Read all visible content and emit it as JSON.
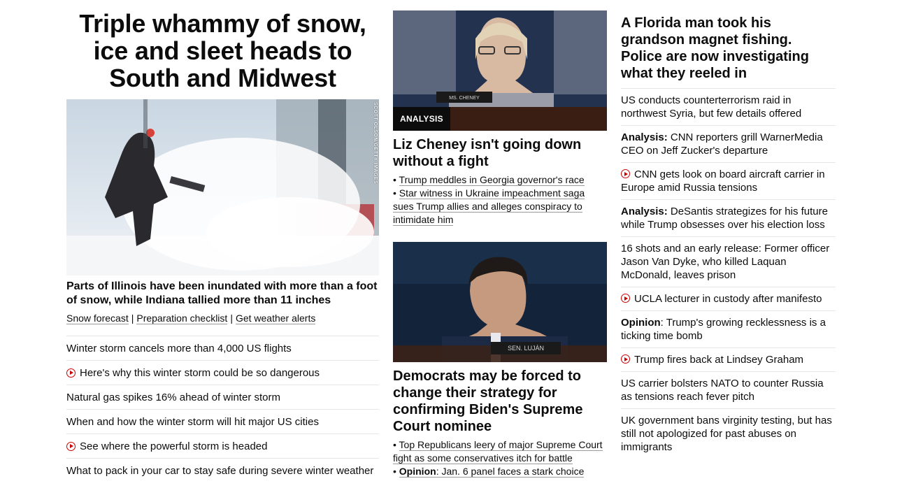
{
  "hero": {
    "title": "Triple whammy of snow, ice and sleet heads to South and Midwest",
    "image_credit": "SCOTT OLSON/GETTY IMAGES",
    "subhead": "Parts of Illinois have been inundated with more than a foot of snow, while Indiana tallied more than 11 inches",
    "links": [
      "Snow forecast",
      "Preparation checklist",
      "Get weather alerts"
    ],
    "separator": "|"
  },
  "storm_list": [
    {
      "text": "Winter storm cancels more than 4,000 US flights",
      "video": false
    },
    {
      "text": "Here's why this winter storm could be so dangerous",
      "video": true
    },
    {
      "text": "Natural gas spikes 16% ahead of winter storm",
      "video": false
    },
    {
      "text": "When and how the winter storm will hit major US cities",
      "video": false
    },
    {
      "text": "See where the powerful storm is headed",
      "video": true
    },
    {
      "text": "What to pack in your car to stay safe during severe winter weather",
      "video": false
    }
  ],
  "cheney": {
    "badge": "ANALYSIS",
    "nameplate": "MS. CHENEY",
    "headline": "Liz Cheney isn't going down without a fight",
    "bullets": [
      "Trump meddles in Georgia governor's race",
      "Star witness in Ukraine impeachment saga sues Trump allies and alleges conspiracy to intimidate him"
    ]
  },
  "lujan": {
    "nameplate": "SEN. LUJÁN",
    "headline": "Democrats may be forced to change their strategy for confirming Biden's Supreme Court nominee",
    "bullet1": "Top Republicans leery of major Supreme Court fight as some conservatives itch for battle",
    "bullet2_label": "Opinion",
    "bullet2_text": ": Jan. 6 panel faces a stark choice"
  },
  "right_col": {
    "headline": "A Florida man took his grandson magnet fishing. Police are now investigating what they reeled in",
    "items": [
      {
        "label": "",
        "text": "US conducts counterterrorism raid in northwest Syria, but few details offered",
        "video": false
      },
      {
        "label": "Analysis:",
        "text": " CNN reporters grill WarnerMedia CEO on Jeff Zucker's departure",
        "video": false
      },
      {
        "label": "",
        "text": "CNN gets look on board aircraft carrier in Europe amid Russia tensions",
        "video": true
      },
      {
        "label": "Analysis:",
        "text": " DeSantis strategizes for his future while Trump obsesses over his election loss",
        "video": false
      },
      {
        "label": "",
        "text": "16 shots and an early release: Former officer Jason Van Dyke, who killed Laquan McDonald, leaves prison",
        "video": false
      },
      {
        "label": "",
        "text": "UCLA lecturer in custody after manifesto",
        "video": true
      },
      {
        "label": "Opinion",
        "text": ": Trump's growing recklessness is a ticking time bomb",
        "video": false
      },
      {
        "label": "",
        "text": "Trump fires back at Lindsey Graham",
        "video": true
      },
      {
        "label": "",
        "text": "US carrier bolsters NATO to counter Russia as tensions reach fever pitch",
        "video": false
      },
      {
        "label": "",
        "text": "UK government bans virginity testing, but has still not apologized for past abuses on immigrants",
        "video": false
      }
    ]
  }
}
